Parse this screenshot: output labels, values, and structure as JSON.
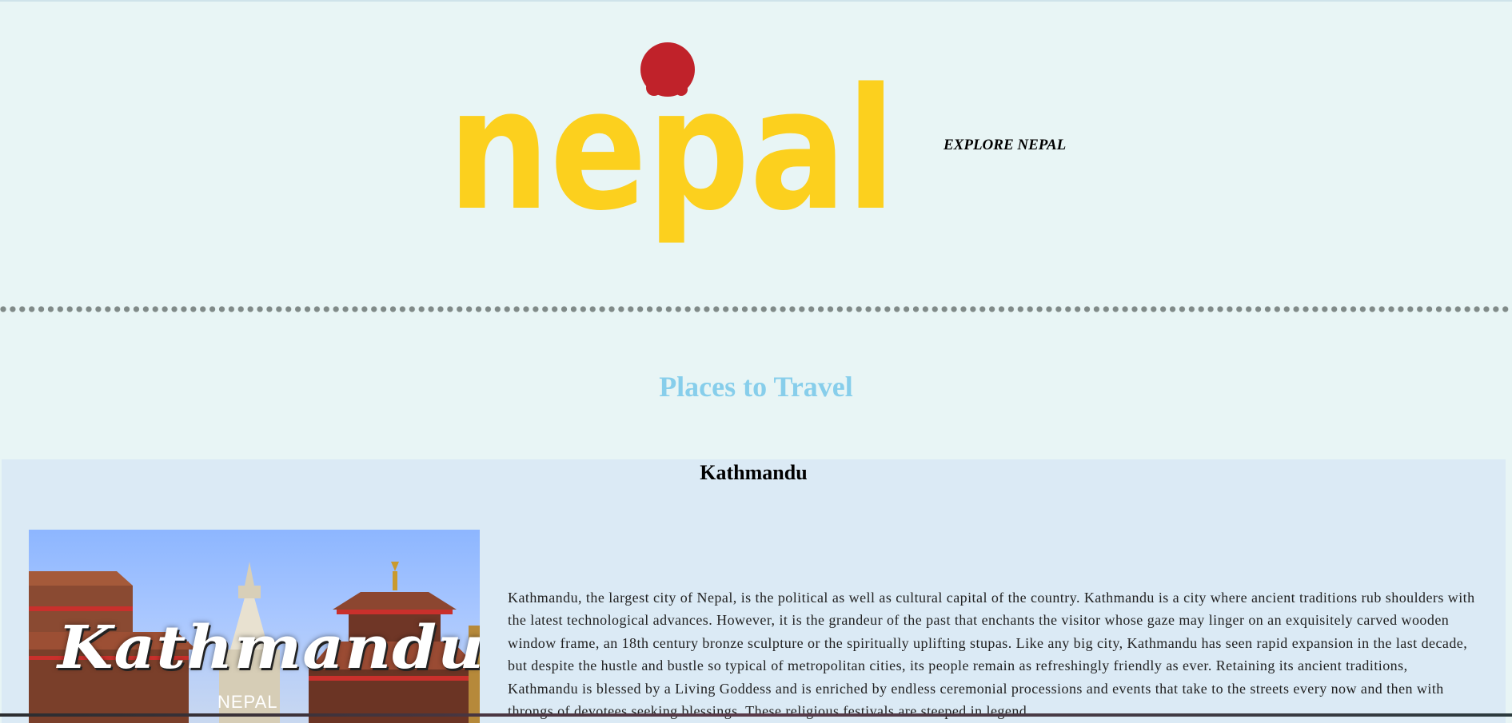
{
  "header": {
    "logo_text": "nepal",
    "tagline": "EXPLORE NEPAL"
  },
  "main": {
    "section_title": "Places to Travel",
    "places": [
      {
        "name": "Kathmandu",
        "image_caption": "Kathmandu",
        "image_subcaption": "NEPAL",
        "description": "Kathmandu, the largest city of Nepal, is the political as well as cultural capital of the country. Kathmandu is a city where ancient traditions rub shoulders with the latest technological advances. However, it is the grandeur of the past that enchants the visitor whose gaze may linger on an exquisitely carved wooden window frame, an 18th century bronze sculpture or the spiritually uplifting stupas. Like any big city, Kathmandu has seen rapid expansion in the last decade, but despite the hustle and bustle so typical of metropolitan cities, its people remain as refreshingly friendly as ever. Retaining its ancient traditions, Kathmandu is blessed by a Living Goddess and is enriched by endless ceremonial processions and events that take to the streets every now and then with throngs of devotees seeking blessings. These religious festivals are steeped in legend"
      }
    ]
  },
  "colors": {
    "page_background": "#e8f5f5",
    "logo_yellow": "#fcd01e",
    "logo_red_sun": "#c0222a",
    "section_title": "#87ceeb",
    "card_background": "#dbeaf5",
    "divider": "#808a88"
  }
}
